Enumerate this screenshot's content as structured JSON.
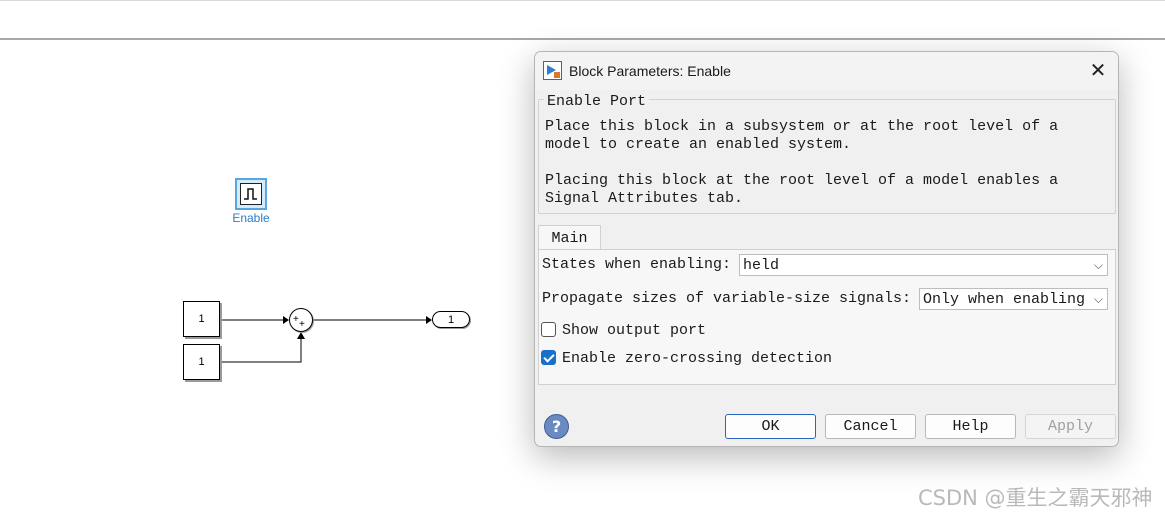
{
  "canvas": {
    "enable_block_label": "Enable",
    "constant_1_value": "1",
    "constant_2_value": "1",
    "sum_signs": [
      "+",
      "+"
    ],
    "outport_number": "1"
  },
  "dialog": {
    "title": "Block Parameters: Enable",
    "group_title": "Enable Port",
    "description_1": [
      "Place this block in a subsystem or at the root level of a",
      "model to create an enabled system."
    ],
    "description_2": [
      "Placing this block at the root level of a model enables a",
      "Signal Attributes tab."
    ],
    "tab_main": "Main",
    "states_label": "States when enabling:",
    "states_value": "held",
    "propagate_label": "Propagate sizes of variable-size signals:",
    "propagate_value": "Only when enabling",
    "show_output_label": "Show output port",
    "show_output_checked": false,
    "zero_crossing_label": "Enable zero-crossing detection",
    "zero_crossing_checked": true,
    "buttons": {
      "ok": "OK",
      "cancel": "Cancel",
      "help": "Help",
      "apply": "Apply"
    },
    "apply_enabled": false
  },
  "watermark": "CSDN @重生之霸天邪神",
  "colors": {
    "accent": "#1a6fc9",
    "enable_label": "#2a7ec8",
    "enable_block_border": "#58a6e0"
  },
  "icons": [
    "matlab-app-icon",
    "close-icon",
    "chevron-down-icon",
    "help-icon",
    "pulse-icon",
    "check-icon"
  ]
}
